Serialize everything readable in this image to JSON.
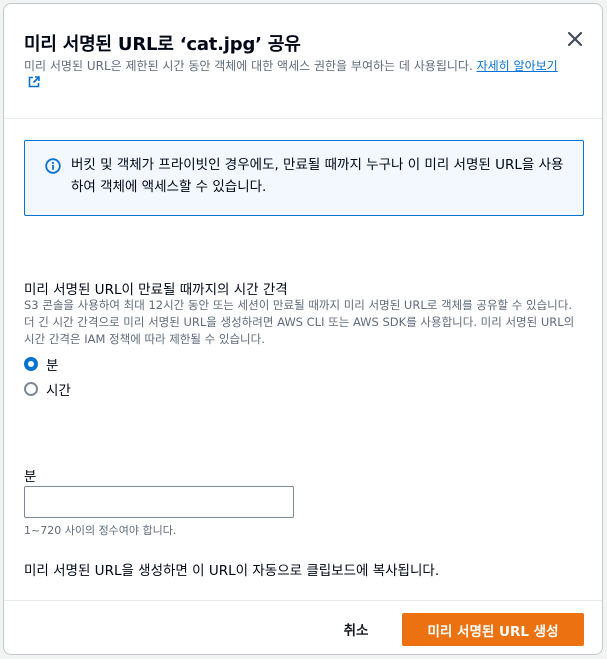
{
  "modal": {
    "title": "미리 서명된 URL로 ‘cat.jpg’ 공유",
    "description": "미리 서명된 URL은 제한된 시간 동안 객체에 대한 액세스 권한을 부여하는 데 사용됩니다.",
    "learn_more": "자세히 알아보기",
    "close_icon": "close-icon"
  },
  "info": {
    "icon": "info-icon",
    "text": "버킷 및 객체가 프라이빗인 경우에도, 만료될 때까지 누구나 이 미리 서명된 URL을 사용하여 객체에 액세스할 수 있습니다."
  },
  "interval": {
    "label": "미리 서명된 URL이 만료될 때까지의 시간 간격",
    "description": "S3 콘솔을 사용하여 최대 12시간 동안 또는 세션이 만료될 때까지 미리 서명된 URL로 객체를 공유할 수 있습니다. 더 긴 시간 간격으로 미리 서명된 URL을 생성하려면 AWS CLI 또는 AWS SDK를 사용합니다. 미리 서명된 URL의 시간 간격은 IAM 정책에 따라 제한될 수 있습니다.",
    "options": [
      {
        "label": "분",
        "selected": true
      },
      {
        "label": "시간",
        "selected": false
      }
    ]
  },
  "minutes_field": {
    "label": "분",
    "value": "",
    "placeholder": "",
    "hint": "1~720 사이의 정수여야 합니다."
  },
  "copy_note": "미리 서명된 URL을 생성하면 이 URL이 자동으로 클립보드에 복사됩니다.",
  "footer": {
    "cancel_label": "취소",
    "create_label": "미리 서명된 URL 생성"
  },
  "colors": {
    "accent": "#0972d3",
    "primary_button": "#ec7211",
    "info_background": "#f2f8fd"
  }
}
